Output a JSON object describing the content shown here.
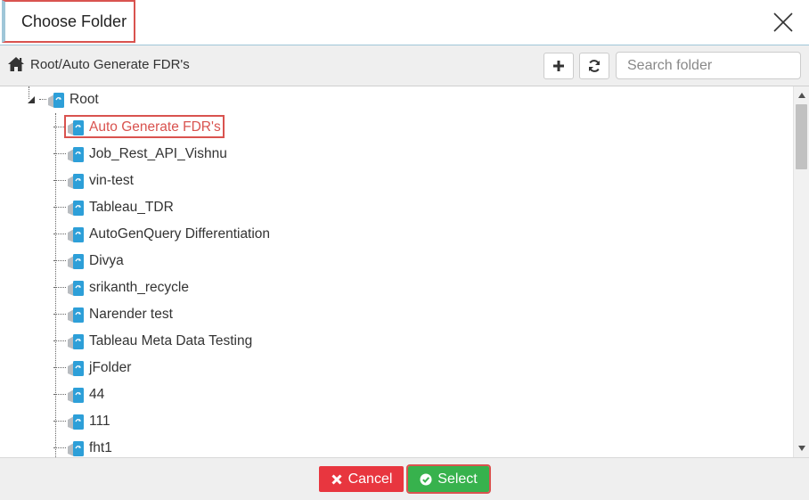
{
  "dialog": {
    "title": "Choose Folder"
  },
  "toolbar": {
    "breadcrumb": "Root/Auto Generate FDR's",
    "search_placeholder": "Search folder"
  },
  "tree": {
    "root_label": "Root",
    "items": [
      {
        "label": "Auto Generate FDR's",
        "selected": true
      },
      {
        "label": "Job_Rest_API_Vishnu"
      },
      {
        "label": "vin-test"
      },
      {
        "label": "Tableau_TDR"
      },
      {
        "label": "AutoGenQuery Differentiation"
      },
      {
        "label": "Divya"
      },
      {
        "label": "srikanth_recycle"
      },
      {
        "label": "Narender test"
      },
      {
        "label": "Tableau Meta Data Testing"
      },
      {
        "label": "jFolder"
      },
      {
        "label": "44"
      },
      {
        "label": "111"
      },
      {
        "label": "fht1"
      }
    ]
  },
  "footer": {
    "cancel_label": "Cancel",
    "select_label": "Select"
  },
  "colors": {
    "accent_red": "#d9534f",
    "cancel_red": "#e8363f",
    "select_green": "#37b24d",
    "folder_blue": "#2d9fd8"
  },
  "icons": {
    "home": "home-icon",
    "add": "plus-icon",
    "refresh": "refresh-icon",
    "close": "close-icon",
    "folder": "folder-icon",
    "cancel": "times-icon",
    "select": "check-circle-icon"
  }
}
